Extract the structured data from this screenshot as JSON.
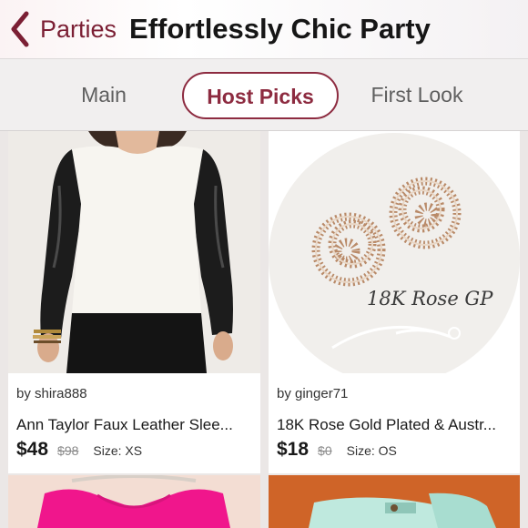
{
  "header": {
    "back_label": "Parties",
    "title": "Effortlessly Chic Party",
    "accent": "#7b1f34"
  },
  "tabs": [
    {
      "label": "Main",
      "active": false
    },
    {
      "label": "Host Picks",
      "active": true
    },
    {
      "label": "First Look",
      "active": false
    }
  ],
  "listings": [
    {
      "seller": "by shira888",
      "title": "Ann Taylor Faux Leather Slee...",
      "price": "$48",
      "original_price": "$98",
      "size": "Size: XS",
      "image": "model-in-white-top-with-black-leather-sleeves"
    },
    {
      "seller": "by ginger71",
      "title": "18K Rose Gold Plated & Austr...",
      "price": "$18",
      "original_price": "$0",
      "size": "Size: OS",
      "image": "rose-shaped-crystal-stud-earrings",
      "image_caption": "18K Rose GP"
    },
    {
      "image": "pink-sleeveless-top-on-hanger"
    },
    {
      "image": "mint-denim-shorts"
    }
  ]
}
